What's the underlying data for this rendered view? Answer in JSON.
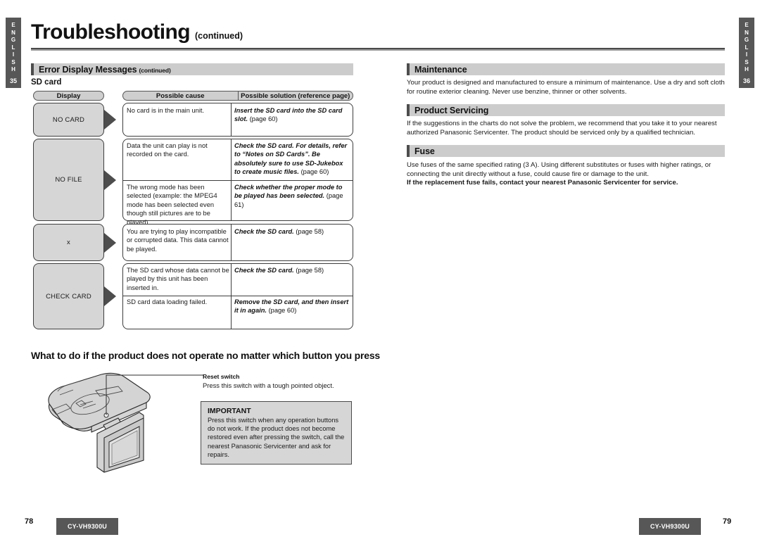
{
  "page": {
    "title": "Troubleshooting",
    "title_continued": "(continued)",
    "left_tab": {
      "language": "ENGLISH",
      "number": "35"
    },
    "right_tab": {
      "language": "ENGLISH",
      "number": "36"
    },
    "footer": {
      "left_page_number": "78",
      "right_page_number": "79",
      "model": "CY-VH9300U"
    }
  },
  "left_column": {
    "section_bar": {
      "label": "Error Display Messages",
      "note": "(continued)"
    },
    "subheading": "SD card",
    "table": {
      "headers": {
        "display": "Display",
        "cause": "Possible cause",
        "solution": "Possible solution (reference page)"
      },
      "rows": [
        {
          "display": "NO CARD",
          "entries": [
            {
              "cause": "No card is in the main unit.",
              "solution_bold": "Insert the SD card into the SD card slot.",
              "solution_tail": " (page 60)"
            }
          ]
        },
        {
          "display": "NO FILE",
          "entries": [
            {
              "cause": "Data the unit can play is not recorded on the card.",
              "solution_bold": "Check the SD card. For details, refer to “Notes on SD Cards”.",
              "solution_bold2": "Be absolutely sure to use SD-Jukebox to create music files.",
              "solution_tail": " (page 60)"
            },
            {
              "cause": "The wrong mode has been selected (example: the MPEG4 mode has been selected even though still pictures are to be played).",
              "solution_bold": "Check whether the proper mode to be played has been selected.",
              "solution_tail": " (page 61)"
            }
          ]
        },
        {
          "display": "x",
          "entries": [
            {
              "cause": "You are trying to play incompatible or corrupted data. This data cannot be played.",
              "solution_bold": "Check the SD card.",
              "solution_tail": " (page 58)"
            }
          ]
        },
        {
          "display": "CHECK CARD",
          "entries": [
            {
              "cause": "The SD card whose data cannot be played by this unit has been inserted in.",
              "solution_bold": "Check the SD card.",
              "solution_tail": " (page 58)"
            },
            {
              "cause": "SD card data loading failed.",
              "solution_bold": "Remove the SD card, and then insert it in again.",
              "solution_tail": " (page 60)"
            }
          ]
        }
      ]
    },
    "reset_section": {
      "heading": "What to do if the product does not operate no matter which button you press",
      "callout_label": "Reset switch",
      "callout_desc": "Press this switch with a tough pointed object.",
      "important_title": "IMPORTANT",
      "important_text": "Press this switch when any operation buttons do not work. If the product does not become restored even after pressing the switch, call the nearest Panasonic Servicenter and ask for repairs."
    }
  },
  "right_column": {
    "sections": [
      {
        "heading": "Maintenance",
        "body": "Your product is designed and manufactured to ensure a minimum of maintenance. Use a dry and soft cloth for routine exterior cleaning. Never use benzine, thinner or other solvents."
      },
      {
        "heading": "Product Servicing",
        "body": "If the suggestions in the charts do not solve the problem, we recommend that you take it to your nearest authorized Panasonic Servicenter. The product should be serviced only by a qualified technician."
      },
      {
        "heading": "Fuse",
        "body": "Use fuses of the same specified rating (3 A). Using different substitutes or fuses with higher ratings, or connecting the unit directly without a fuse, could cause fire or damage to the unit.",
        "body_bold": "If the replacement fuse fails, contact your nearest Panasonic Servicenter for service."
      }
    ]
  },
  "colors": {
    "tab_gray": "#575757",
    "bar_gray": "#cccccc",
    "box_gray": "#d6d6d6",
    "arrow_gray": "#4d4d4d",
    "rule_dark": "#4a4a4a"
  }
}
